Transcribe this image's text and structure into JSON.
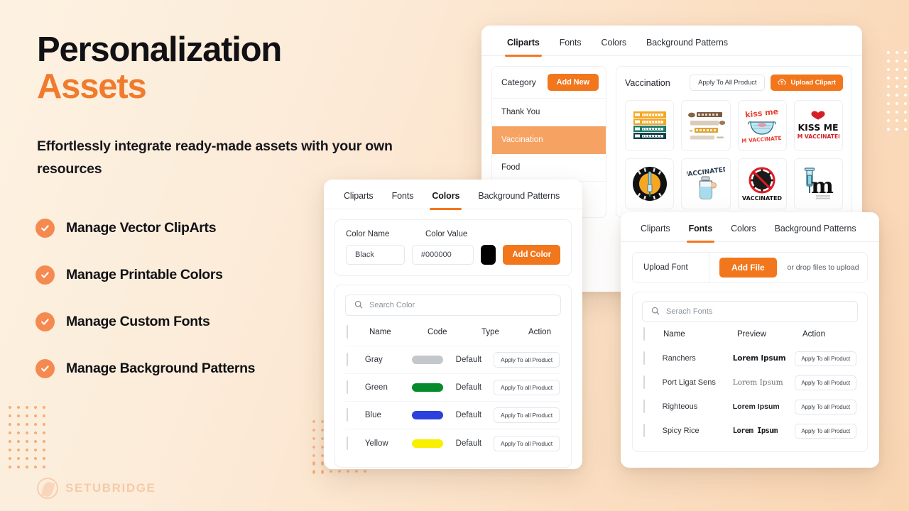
{
  "hero": {
    "title_line1": "Personalization",
    "title_line2": "Assets",
    "subtitle": "Effortlessly integrate ready-made assets with your own resources",
    "accent_color": "#f07b2d"
  },
  "features": [
    {
      "label": "Manage Vector ClipArts",
      "icon": "check-circle-icon"
    },
    {
      "label": "Manage Printable Colors",
      "icon": "check-circle-icon"
    },
    {
      "label": "Manage Custom Fonts",
      "icon": "check-circle-icon"
    },
    {
      "label": "Manage Background Patterns",
      "icon": "check-circle-icon"
    }
  ],
  "watermark": {
    "brand": "SETUBRIDGE",
    "color": "#eda26f"
  },
  "cliparts_card": {
    "tabs": [
      {
        "label": "Cliparts",
        "active": true
      },
      {
        "label": "Fonts",
        "active": false
      },
      {
        "label": "Colors",
        "active": false
      },
      {
        "label": "Background Patterns",
        "active": false
      }
    ],
    "sidebar": {
      "heading": "Category",
      "add_button": "Add New",
      "categories": [
        {
          "label": "Thank You",
          "selected": false
        },
        {
          "label": "Vaccination",
          "selected": true
        },
        {
          "label": "Food",
          "selected": false
        }
      ]
    },
    "content": {
      "title": "Vaccination",
      "apply_button": "Apply To All Product",
      "upload_button": "Upload Clipart",
      "upload_icon": "cloud-upload-icon",
      "thumbnails": [
        {
          "name": "educated-graduated-vaccinated-badge-clipart"
        },
        {
          "name": "educated-graduated-vaccinated-script-clipart"
        },
        {
          "name": "kiss-me-im-vaccinated-mask-clipart"
        },
        {
          "name": "kiss-me-im-vaccinated-lips-clipart"
        },
        {
          "name": "vaccine-syringe-circle-badge-clipart"
        },
        {
          "name": "vaccinated-bottle-clipart"
        },
        {
          "name": "no-virus-vaccinated-clipart"
        },
        {
          "name": "syringe-m-monogram-clipart"
        }
      ]
    }
  },
  "colors_card": {
    "tabs": [
      {
        "label": "Cliparts",
        "active": false
      },
      {
        "label": "Fonts",
        "active": false
      },
      {
        "label": "Colors",
        "active": true
      },
      {
        "label": "Background Patterns",
        "active": false
      }
    ],
    "add_form": {
      "name_label": "Color Name",
      "value_label": "Color Value",
      "name_value": "Black",
      "hex_value": "#000000",
      "swatch": "#000000",
      "add_button": "Add Color"
    },
    "search_placeholder": "Search Color",
    "search_icon": "search-icon",
    "columns": [
      "Name",
      "Code",
      "Type",
      "Action"
    ],
    "rows": [
      {
        "name": "Gray",
        "code": "#c4c7cc",
        "type": "Default",
        "action": "Apply To all Product"
      },
      {
        "name": "Green",
        "code": "#068b2b",
        "type": "Default",
        "action": "Apply To all Product"
      },
      {
        "name": "Blue",
        "code": "#2b40dd",
        "type": "Default",
        "action": "Apply To all Product"
      },
      {
        "name": "Yellow",
        "code": "#f9f000",
        "type": "Default",
        "action": "Apply To all Product"
      }
    ]
  },
  "fonts_card": {
    "tabs": [
      {
        "label": "Cliparts",
        "active": false
      },
      {
        "label": "Fonts",
        "active": true
      },
      {
        "label": "Colors",
        "active": false
      },
      {
        "label": "Background Patterns",
        "active": false
      }
    ],
    "upload": {
      "label": "Upload Font",
      "button": "Add File",
      "hint": "or drop files to upload"
    },
    "search_placeholder": "Serach Fonts",
    "search_icon": "search-icon",
    "columns": [
      "Name",
      "Preview",
      "Action"
    ],
    "rows": [
      {
        "name": "Ranchers",
        "preview": "Lorem Ipsum",
        "action": "Apply To all Product"
      },
      {
        "name": "Port Ligat Sens",
        "preview": "Lorem Ipsum",
        "action": "Apply To all Product"
      },
      {
        "name": "Righteous",
        "preview": "Lorem Ipsum",
        "action": "Apply To all Product"
      },
      {
        "name": "Spicy Rice",
        "preview": "Lorem Ipsum",
        "action": "Apply To all Product"
      }
    ]
  }
}
